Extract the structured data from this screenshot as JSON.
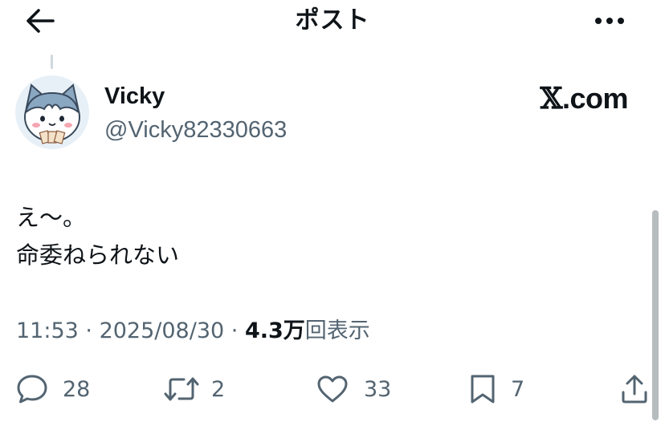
{
  "header": {
    "title": "ポスト",
    "back_icon": "arrow-left-icon",
    "more_icon": "more-dots-icon"
  },
  "author": {
    "display_name": "Vicky",
    "handle": "@Vicky82330663",
    "avatar": "cat-character-avatar"
  },
  "brand": {
    "x_letter": "𝕏",
    "suffix": ".com"
  },
  "post": {
    "lines": [
      "え〜。",
      "命委ねられない"
    ]
  },
  "meta": {
    "time": "11:53",
    "separator": " · ",
    "date": "2025/08/30",
    "views_count": "4.3万",
    "views_suffix": "回表示"
  },
  "actions": {
    "reply_count": "28",
    "repost_count": "2",
    "like_count": "33",
    "bookmark_count": "7"
  },
  "colors": {
    "text_primary": "#0f1419",
    "text_secondary": "#536471",
    "background": "#ffffff"
  }
}
